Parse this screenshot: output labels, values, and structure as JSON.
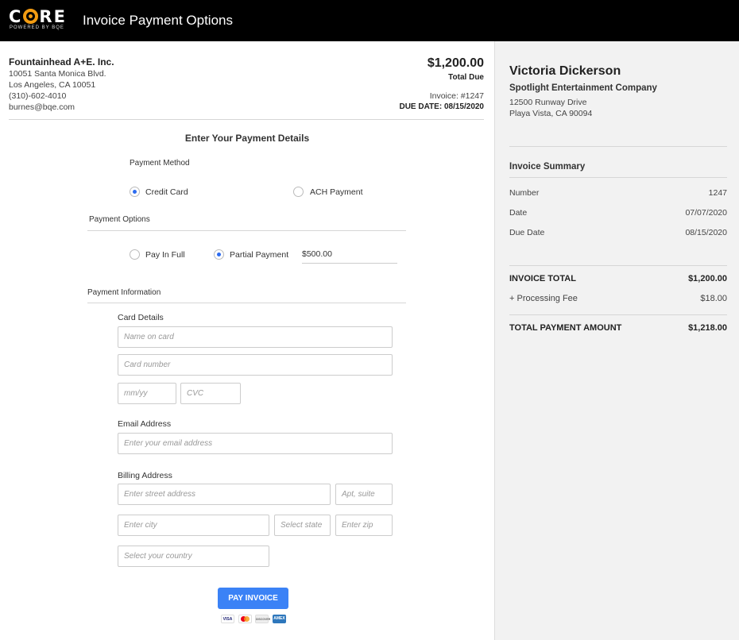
{
  "header": {
    "logo_text_c": "C",
    "logo_text_re": "RE",
    "logo_sub": "POWERED BY BQE",
    "title": "Invoice Payment Options"
  },
  "company": {
    "name": "Fountainhead A+E. Inc.",
    "address1": "10051 Santa Monica Blvd.",
    "address2": "Los Angeles, CA 10051",
    "phone": "(310)-602-4010",
    "email": "burnes@bqe.com"
  },
  "invoice": {
    "amount": "$1,200.00",
    "amount_label": "Total Due",
    "number": "Invoice: #1247",
    "due": "DUE DATE: 08/15/2020"
  },
  "form": {
    "title": "Enter Your Payment Details",
    "payment_method_label": "Payment Method",
    "methods": [
      {
        "label": "Credit Card",
        "selected": true
      },
      {
        "label": "ACH Payment",
        "selected": false
      }
    ],
    "payment_options_label": "Payment Options",
    "options": [
      {
        "label": "Pay In Full",
        "selected": false
      },
      {
        "label": "Partial Payment",
        "selected": true
      }
    ],
    "partial_amount": "$500.00",
    "payment_info_label": "Payment Information",
    "card_details_label": "Card Details",
    "name_placeholder": "Name on card",
    "card_number_placeholder": "Card number",
    "expiry_placeholder": "mm/yy",
    "cvc_placeholder": "CVC",
    "email_label": "Email Address",
    "email_placeholder": "Enter your email address",
    "billing_label": "Billing Address",
    "street_placeholder": "Enter street address",
    "apt_placeholder": "Apt, suite",
    "city_placeholder": "Enter city",
    "state_placeholder": "Select state",
    "zip_placeholder": "Enter zip",
    "country_placeholder": "Select your country",
    "pay_button": "PAY INVOICE",
    "cards": [
      "VISA",
      "MC",
      "DISCOVER",
      "AMEX"
    ]
  },
  "customer": {
    "name": "Victoria Dickerson",
    "company": "Spotlight Entertainment Company",
    "address1": "12500 Runway Drive",
    "address2": "Playa Vista, CA 90094"
  },
  "summary": {
    "title": "Invoice Summary",
    "rows": [
      {
        "label": "Number",
        "value": "1247"
      },
      {
        "label": "Date",
        "value": "07/07/2020"
      },
      {
        "label": "Due Date",
        "value": "08/15/2020"
      }
    ],
    "invoice_total_label": "INVOICE TOTAL",
    "invoice_total": "$1,200.00",
    "fee_label": "+ Processing Fee",
    "fee": "$18.00",
    "payment_total_label": "TOTAL PAYMENT AMOUNT",
    "payment_total": "$1,218.00"
  },
  "colors": {
    "accent": "#3b82f6",
    "logo": "#f39c12",
    "header_bg": "#000000",
    "sidebar_bg": "#f2f2f2"
  }
}
